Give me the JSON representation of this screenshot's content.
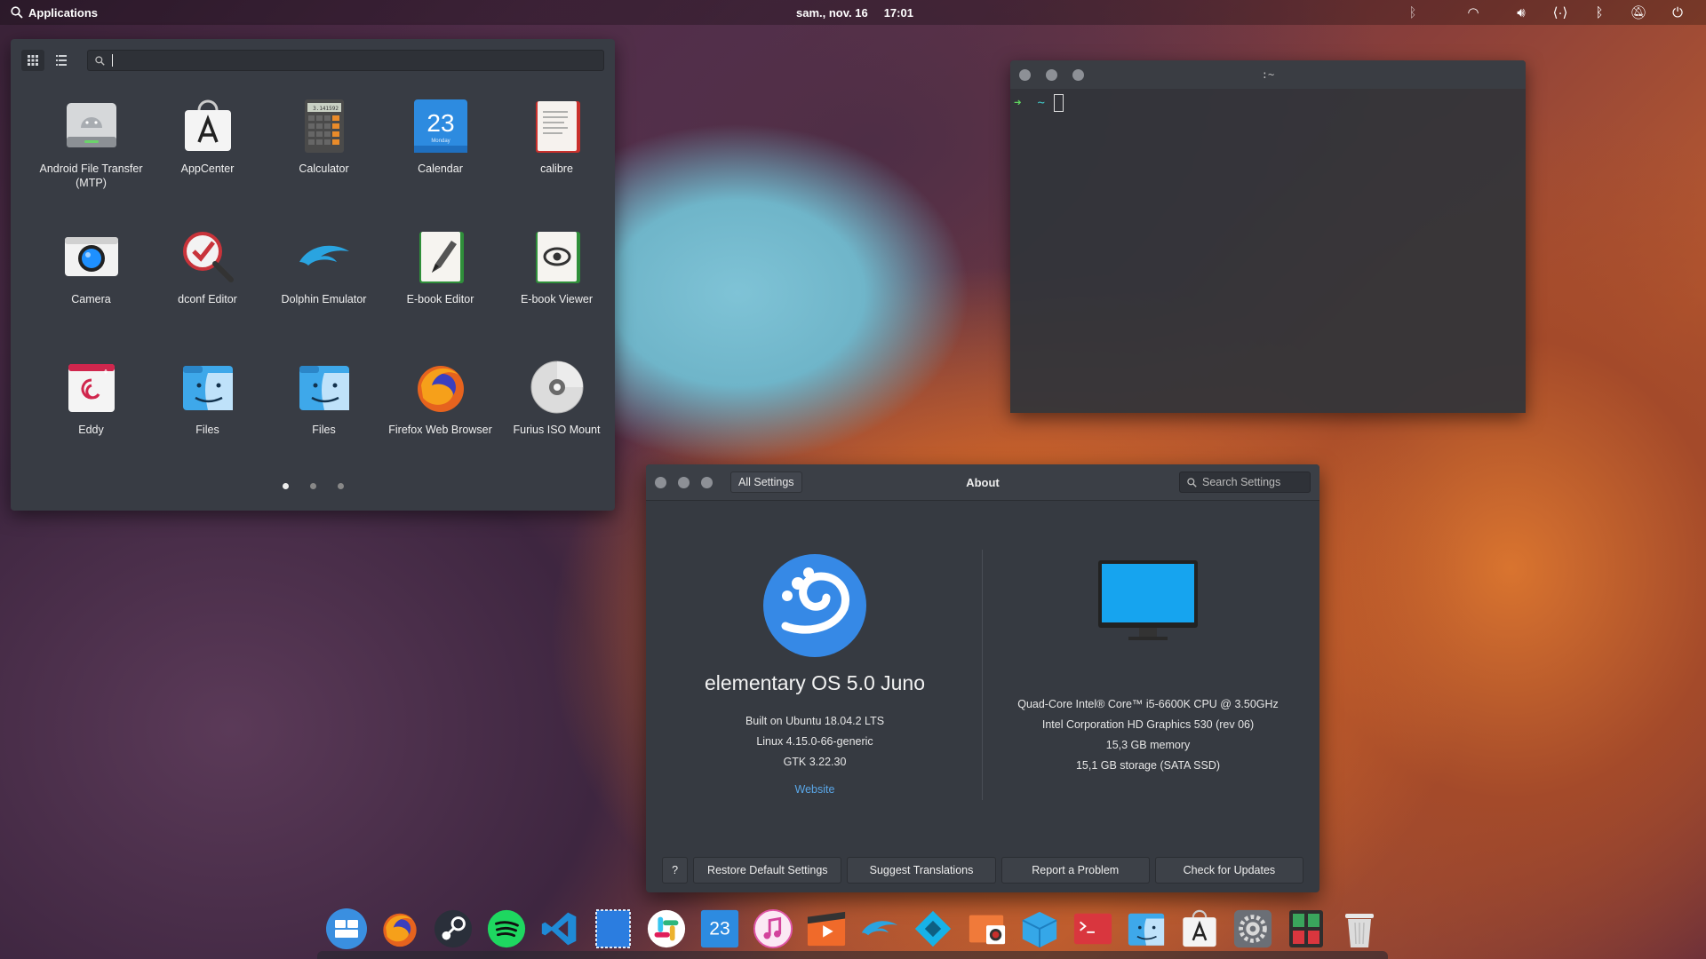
{
  "topbar": {
    "applications_label": "Applications",
    "date": "sam., nov. 16",
    "time": "17:01"
  },
  "app_menu": {
    "search_value": "",
    "apps": [
      {
        "label": "Android File Transfer (MTP)",
        "icon": "android-file-transfer-icon"
      },
      {
        "label": "AppCenter",
        "icon": "appcenter-icon"
      },
      {
        "label": "Calculator",
        "icon": "calculator-icon"
      },
      {
        "label": "Calendar",
        "icon": "calendar-icon",
        "day": "23",
        "weekday": "Monday"
      },
      {
        "label": "calibre",
        "icon": "calibre-icon"
      },
      {
        "label": "Camera",
        "icon": "camera-icon"
      },
      {
        "label": "dconf Editor",
        "icon": "dconf-editor-icon"
      },
      {
        "label": "Dolphin Emulator",
        "icon": "dolphin-emulator-icon"
      },
      {
        "label": "E-book Editor",
        "icon": "ebook-editor-icon"
      },
      {
        "label": "E-book Viewer",
        "icon": "ebook-viewer-icon"
      },
      {
        "label": "Eddy",
        "icon": "eddy-icon"
      },
      {
        "label": "Files",
        "icon": "files-icon"
      },
      {
        "label": "Files",
        "icon": "files-icon"
      },
      {
        "label": "Firefox Web Browser",
        "icon": "firefox-icon"
      },
      {
        "label": "Furius ISO Mount",
        "icon": "iso-mount-icon"
      }
    ],
    "calculator_display": "3.141592",
    "pages": 3,
    "current_page": 1
  },
  "terminal": {
    "title": ":~",
    "prompt_symbol": "➜",
    "prompt_dir": "~"
  },
  "about": {
    "all_settings_label": "All Settings",
    "title": "About",
    "search_placeholder": "Search Settings",
    "os_name": "elementary OS 5.0 Juno",
    "os_info": [
      "Built on Ubuntu 18.04.2 LTS",
      "Linux 4.15.0-66-generic",
      "GTK 3.22.30"
    ],
    "website_label": "Website",
    "hw_info": [
      "Quad-Core Intel® Core™ i5-6600K CPU @ 3.50GHz",
      "Intel Corporation HD Graphics 530 (rev 06)",
      "15,3 GB memory",
      "15,1 GB storage (SATA SSD)"
    ],
    "buttons": {
      "help": "?",
      "restore": "Restore Default Settings",
      "translations": "Suggest Translations",
      "report": "Report a Problem",
      "updates": "Check for Updates"
    }
  },
  "dock": {
    "items": [
      "multitasking-icon",
      "firefox-icon",
      "steam-icon",
      "spotify-icon",
      "vscode-icon",
      "notes-icon",
      "slack-icon",
      "calendar-icon",
      "music-icon",
      "videos-icon",
      "dolphin-emulator-icon",
      "kodi-icon",
      "photos-icon",
      "box-icon",
      "terminal-icon",
      "files-icon",
      "appcenter-icon",
      "settings-icon",
      "calculator-icon",
      "trash-icon"
    ],
    "calendar_day": "23"
  },
  "colors": {
    "accent": "#3689e6",
    "panel": "#383c44",
    "link": "#5aa7e8"
  }
}
